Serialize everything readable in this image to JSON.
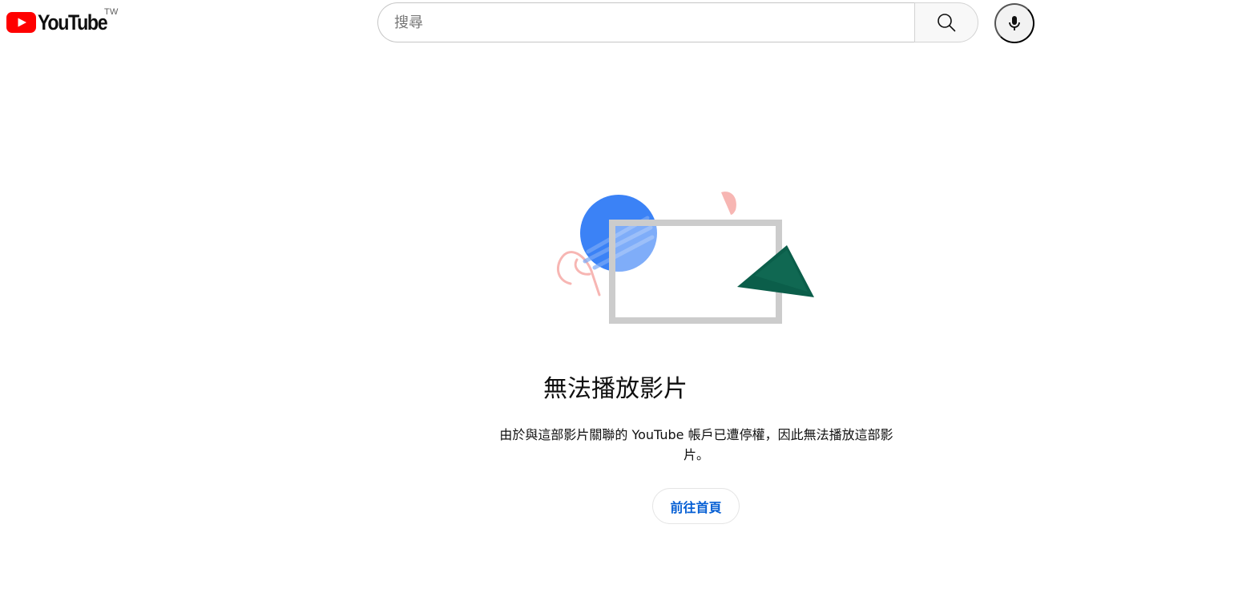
{
  "masthead": {
    "logo_text": "YouTube",
    "region_code": "TW",
    "search": {
      "placeholder": "搜尋",
      "value": ""
    },
    "icons": {
      "logo": "youtube-logo-icon",
      "search": "search-icon",
      "mic": "microphone-icon"
    }
  },
  "error": {
    "title": "無法播放影片",
    "message": "由於與這部影片關聯的 YouTube 帳戶已遭停權，因此無法播放這部影片。",
    "home_button_label": "前往首頁",
    "illustration": "unavailable-video-illustration"
  },
  "colors": {
    "brand_red": "#ff0000",
    "link_blue": "#065fd4",
    "illustration_blue": "#3b82f6",
    "illustration_green": "#0b5e4a",
    "illustration_pink": "#f7b6b3",
    "frame_gray": "#cccccc"
  }
}
